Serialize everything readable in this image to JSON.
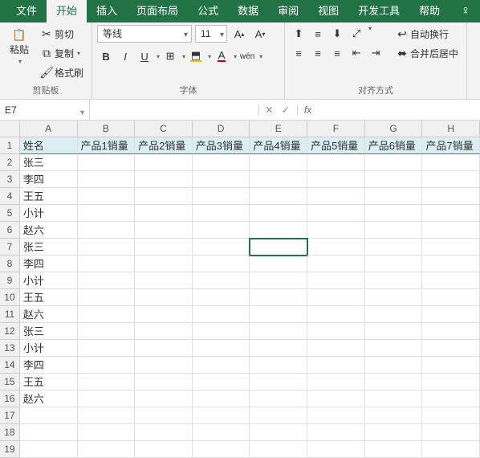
{
  "tabs": [
    "文件",
    "开始",
    "插入",
    "页面布局",
    "公式",
    "数据",
    "审阅",
    "视图",
    "开发工具",
    "帮助"
  ],
  "activeTab": 1,
  "clipboard": {
    "cut": "剪切",
    "copy": "复制",
    "format": "格式刷",
    "paste": "粘贴",
    "group": "剪贴板"
  },
  "font": {
    "name": "等线",
    "size": "11",
    "group": "字体",
    "bold": "B",
    "italic": "I",
    "underline": "U",
    "wen": "wén"
  },
  "align": {
    "group": "对齐方式",
    "wrap": "自动换行",
    "merge": "合并后居中"
  },
  "namebox": "E7",
  "fx": "fx",
  "cols": [
    "A",
    "B",
    "C",
    "D",
    "E",
    "F",
    "G",
    "H"
  ],
  "rows": [
    [
      "姓名",
      "产品1销量",
      "产品2销量",
      "产品3销量",
      "产品4销量",
      "产品5销量",
      "产品6销量",
      "产品7销量"
    ],
    [
      "张三",
      "",
      "",
      "",
      "",
      "",
      "",
      ""
    ],
    [
      "李四",
      "",
      "",
      "",
      "",
      "",
      "",
      ""
    ],
    [
      "王五",
      "",
      "",
      "",
      "",
      "",
      "",
      ""
    ],
    [
      "小计",
      "",
      "",
      "",
      "",
      "",
      "",
      ""
    ],
    [
      "赵六",
      "",
      "",
      "",
      "",
      "",
      "",
      ""
    ],
    [
      "张三",
      "",
      "",
      "",
      "",
      "",
      "",
      ""
    ],
    [
      "李四",
      "",
      "",
      "",
      "",
      "",
      "",
      ""
    ],
    [
      "小计",
      "",
      "",
      "",
      "",
      "",
      "",
      ""
    ],
    [
      "王五",
      "",
      "",
      "",
      "",
      "",
      "",
      ""
    ],
    [
      "赵六",
      "",
      "",
      "",
      "",
      "",
      "",
      ""
    ],
    [
      "张三",
      "",
      "",
      "",
      "",
      "",
      "",
      ""
    ],
    [
      "小计",
      "",
      "",
      "",
      "",
      "",
      "",
      ""
    ],
    [
      "李四",
      "",
      "",
      "",
      "",
      "",
      "",
      ""
    ],
    [
      "王五",
      "",
      "",
      "",
      "",
      "",
      "",
      ""
    ],
    [
      "赵六",
      "",
      "",
      "",
      "",
      "",
      "",
      ""
    ],
    [
      "",
      "",
      "",
      "",
      "",
      "",
      "",
      ""
    ],
    [
      "",
      "",
      "",
      "",
      "",
      "",
      "",
      ""
    ],
    [
      "",
      "",
      "",
      "",
      "",
      "",
      "",
      ""
    ]
  ],
  "selectedCell": {
    "row": 6,
    "col": 4
  }
}
